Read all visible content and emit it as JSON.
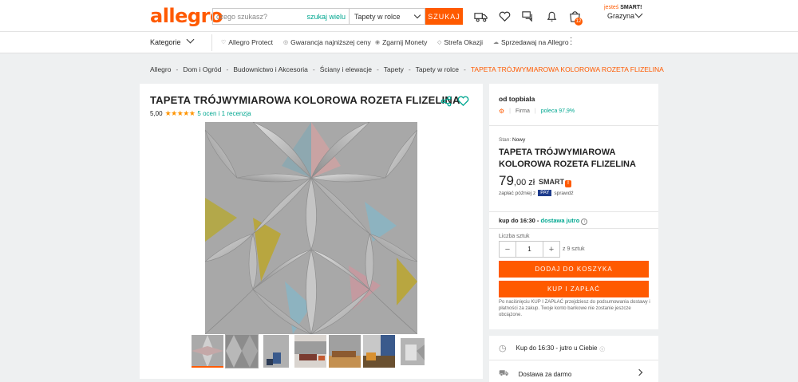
{
  "header": {
    "logo": "allegro",
    "search_placeholder": "czego szukasz?",
    "search_scope": "szukaj wielu",
    "category_select": "Tapety w rolce",
    "search_button": "SZUKAJ",
    "cart_count": "12",
    "smart_prefix": "jesteś",
    "smart_label": "SMART!",
    "user_name": "Grazyna"
  },
  "nav": {
    "categories": "Kategorie",
    "items": [
      "Allegro Protect",
      "Gwarancja najniższej ceny",
      "Zgarnij Monety",
      "Strefa Okazji",
      "Sprzedawaj na Allegro"
    ]
  },
  "breadcrumb": [
    "Allegro",
    "Dom i Ogród",
    "Budownictwo i Akcesoria",
    "Ściany i elewacje",
    "Tapety",
    "Tapety w rolce",
    "TAPETA TRÓJWYMIAROWA KOLOROWA ROZETA FLIZELINA"
  ],
  "product": {
    "title": "TAPETA TRÓJWYMIAROWA KOLOROWA ROZETA FLIZELINA",
    "rating": "5,00",
    "stars": "★★★★★",
    "reviews": "5 ocen i 1 recenzja"
  },
  "offer": {
    "seller_prefix": "od",
    "seller": "topbiala",
    "seller_type": "Firma",
    "recommend": "poleca 97,9%",
    "condition_label": "Stan:",
    "condition": "Nowy",
    "title": "TAPETA TRÓJWYMIAROWA KOLOROWA ROZETA FLIZELINA",
    "price_main": "79",
    "price_cents": ",00 zł",
    "smart": "SMART",
    "pay_later": "zapłać później z",
    "pay_badge": "PAY",
    "pay_check": "sprawdź",
    "delivery_prefix": "kup do 16:30 -",
    "delivery_day": "dostawa jutro",
    "quantity_label": "Liczba sztuk",
    "quantity": "1",
    "quantity_of": "z 9 sztuk",
    "add_to_cart": "DODAJ DO KOSZYKA",
    "buy_now": "KUP I ZAPŁAĆ",
    "disclaimer": "Po naciśnięciu KUP I ZAPŁAĆ przejdziesz do podsumowania dostawy i płatności za zakup. Twoje konto bankowe nie zostanie jeszcze obciążone."
  },
  "shipping": {
    "time_row": "Kup do 16:30 - jutro u Ciebie",
    "free_row": "Dostawa za darmo"
  },
  "colors": {
    "brand": "#ff5a00",
    "teal": "#00a790",
    "star": "#ff9400"
  }
}
